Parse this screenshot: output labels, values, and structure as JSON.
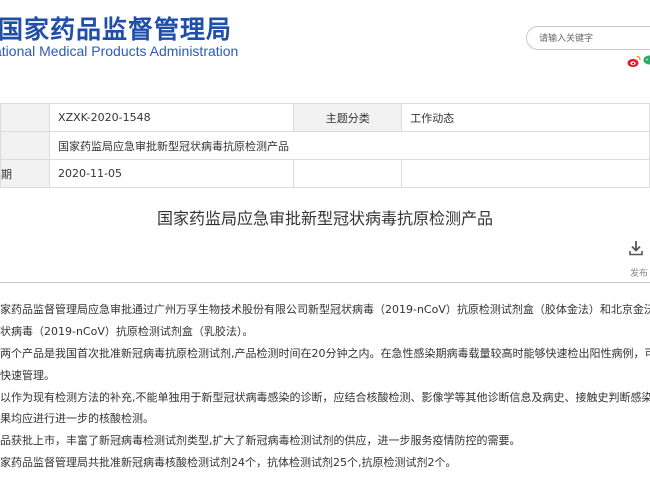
{
  "site": {
    "name_cn": "国家药品监督管理局",
    "name_en": "ational Medical Products Administration"
  },
  "search": {
    "placeholder": "请输入关键字"
  },
  "social": [
    "weibo-icon",
    "wechat-icon"
  ],
  "meta": {
    "row1": {
      "value1": "XZXK-2020-1548",
      "key2": "主题分类",
      "value2": "工作动态"
    },
    "row2": {
      "value": "国家药监局应急审批新型冠状病毒抗原检测产品"
    },
    "row3": {
      "key": "期",
      "value": "2020-11-05"
    }
  },
  "article": {
    "title": "国家药监局应急审批新型冠状病毒抗原检测产品",
    "publish_label": "发布",
    "paragraphs": [
      "家药品监督管理局应急审批通过广州万孚生物技术股份有限公司新型冠状病毒（2019-nCoV）抗原检测试剂盒（胶体金法）和北京金沃夫",
      "状病毒（2019-nCoV）抗原检测试剂盒（乳胶法）。",
      "两个产品是我国首次批准新冠病毒抗原检测试剂,产品检测时间在20分钟之内。在急性感染期病毒载量较高时能够快速检出阳性病例，可以",
      "快速管理。",
      "以作为现有检测方法的补充,不能单独用于新型冠状病毒感染的诊断，应结合核酸检测、影像学等其他诊断信息及病史、接触史判断感染状态",
      "果均应进行进一步的核酸检测。",
      "品获批上市，丰富了新冠病毒检测试剂类型,扩大了新冠病毒检测试剂的供应，进一步服务疫情防控的需要。",
      "家药品监督管理局共批准新冠病毒核酸检测试剂24个，抗体检测试剂25个,抗原检测试剂2个。"
    ]
  }
}
